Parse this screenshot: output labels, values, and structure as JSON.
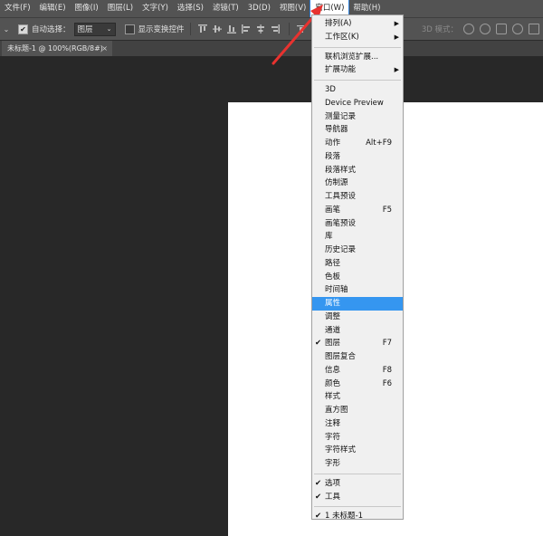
{
  "menubar": {
    "items": [
      "文件(F)",
      "编辑(E)",
      "图像(I)",
      "图层(L)",
      "文字(Y)",
      "选择(S)",
      "滤镜(T)",
      "3D(D)",
      "视图(V)",
      "窗口(W)",
      "帮助(H)"
    ],
    "active": "窗口(W)"
  },
  "options": {
    "auto_select_label": "自动选择：",
    "auto_select_value": "图层",
    "show_transform_label": "显示变换控件",
    "mode_3d_label": "3D 模式："
  },
  "tab": {
    "title": "未标题-1 @ 100%(RGB/8#)",
    "close": "×"
  },
  "window_menu": {
    "group1": [
      {
        "label": "排列(A)",
        "submenu": true
      },
      {
        "label": "工作区(K)",
        "submenu": true
      }
    ],
    "group2": [
      {
        "label": "联机浏览扩展..."
      },
      {
        "label": "扩展功能",
        "submenu": true
      }
    ],
    "group3": [
      {
        "label": "3D"
      },
      {
        "label": "Device Preview"
      },
      {
        "label": "测量记录"
      },
      {
        "label": "导航器"
      },
      {
        "label": "动作",
        "shortcut": "Alt+F9"
      },
      {
        "label": "段落"
      },
      {
        "label": "段落样式"
      },
      {
        "label": "仿制源"
      },
      {
        "label": "工具预设"
      },
      {
        "label": "画笔",
        "shortcut": "F5"
      },
      {
        "label": "画笔预设"
      },
      {
        "label": "库"
      },
      {
        "label": "历史记录"
      },
      {
        "label": "路径"
      },
      {
        "label": "色板"
      },
      {
        "label": "时间轴"
      },
      {
        "label": "属性",
        "highlighted": true
      },
      {
        "label": "调整"
      },
      {
        "label": "通道"
      },
      {
        "label": "图层",
        "shortcut": "F7",
        "checked": true
      },
      {
        "label": "图层复合"
      },
      {
        "label": "信息",
        "shortcut": "F8"
      },
      {
        "label": "颜色",
        "shortcut": "F6"
      },
      {
        "label": "样式"
      },
      {
        "label": "直方图"
      },
      {
        "label": "注释"
      },
      {
        "label": "字符"
      },
      {
        "label": "字符样式"
      },
      {
        "label": "字形"
      }
    ],
    "group4": [
      {
        "label": "选项",
        "checked": true
      },
      {
        "label": "工具",
        "checked": true
      }
    ],
    "group5": [
      {
        "label": "1 未标题-1",
        "checked": true
      }
    ]
  },
  "colors": {
    "highlight": "#3596f0",
    "annotation_arrow": "#e8322f",
    "panel_bg": "#535353"
  }
}
